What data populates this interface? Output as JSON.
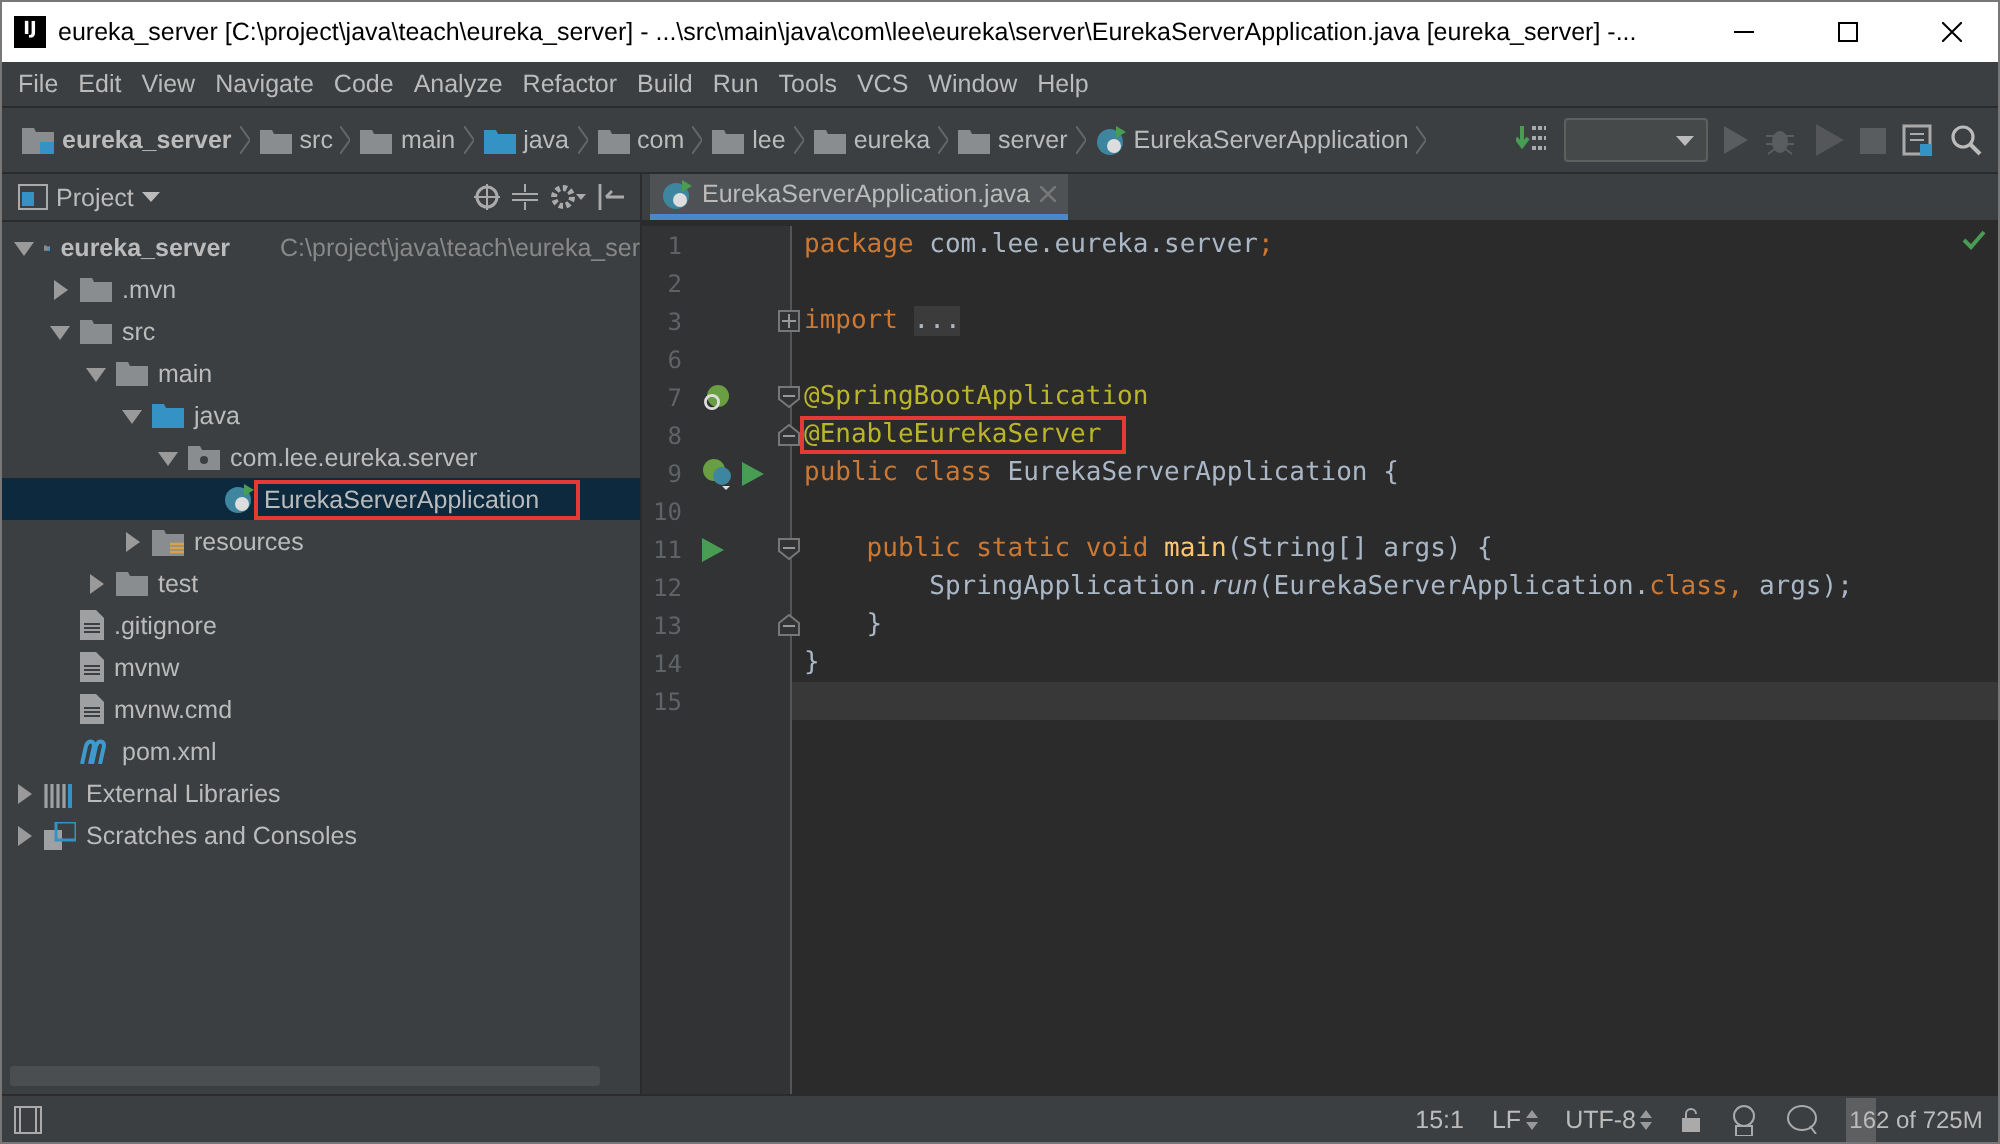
{
  "window": {
    "logo": "IJ",
    "title": "eureka_server [C:\\project\\java\\teach\\eureka_server] - ...\\src\\main\\java\\com\\lee\\eureka\\server\\EurekaServerApplication.java [eureka_server] -..."
  },
  "menu": [
    {
      "label": "File"
    },
    {
      "label": "Edit"
    },
    {
      "label": "View"
    },
    {
      "label": "Navigate"
    },
    {
      "label": "Code"
    },
    {
      "label": "Analyze"
    },
    {
      "label": "Refactor"
    },
    {
      "label": "Build"
    },
    {
      "label": "Run"
    },
    {
      "label": "Tools"
    },
    {
      "label": "VCS"
    },
    {
      "label": "Window"
    },
    {
      "label": "Help"
    }
  ],
  "breadcrumbs": [
    {
      "label": "eureka_server",
      "kind": "module"
    },
    {
      "label": "src",
      "kind": "folder"
    },
    {
      "label": "main",
      "kind": "folder"
    },
    {
      "label": "java",
      "kind": "source"
    },
    {
      "label": "com",
      "kind": "package"
    },
    {
      "label": "lee",
      "kind": "package"
    },
    {
      "label": "eureka",
      "kind": "package"
    },
    {
      "label": "server",
      "kind": "package"
    },
    {
      "label": "EurekaServerApplication",
      "kind": "class"
    }
  ],
  "project_panel": {
    "title": "Project",
    "tree": [
      {
        "label": "eureka_server",
        "path": "C:\\project\\java\\teach\\eureka_ser",
        "kind": "module",
        "expanded": true,
        "selected": false,
        "marked": false,
        "children": [
          {
            "label": ".mvn",
            "kind": "folder",
            "expanded": false,
            "selected": false,
            "marked": false
          },
          {
            "label": "src",
            "kind": "folder",
            "expanded": true,
            "selected": false,
            "marked": false,
            "children": [
              {
                "label": "main",
                "kind": "folder",
                "expanded": true,
                "selected": false,
                "marked": false,
                "children": [
                  {
                    "label": "java",
                    "kind": "source",
                    "expanded": true,
                    "selected": false,
                    "marked": false,
                    "children": [
                      {
                        "label": "com.lee.eureka.server",
                        "kind": "package",
                        "expanded": true,
                        "selected": false,
                        "marked": false,
                        "children": [
                          {
                            "label": "EurekaServerApplication",
                            "kind": "class",
                            "selected": true,
                            "marked": true
                          }
                        ]
                      }
                    ]
                  },
                  {
                    "label": "resources",
                    "kind": "resources",
                    "expanded": false,
                    "selected": false,
                    "marked": false
                  }
                ]
              },
              {
                "label": "test",
                "kind": "folder",
                "expanded": false,
                "selected": false,
                "marked": false
              }
            ]
          },
          {
            "label": ".gitignore",
            "kind": "file",
            "selected": false,
            "marked": false
          },
          {
            "label": "mvnw",
            "kind": "file",
            "selected": false,
            "marked": false
          },
          {
            "label": "mvnw.cmd",
            "kind": "file",
            "selected": false,
            "marked": false
          },
          {
            "label": "pom.xml",
            "kind": "maven",
            "selected": false,
            "marked": false
          }
        ]
      },
      {
        "label": "External Libraries",
        "kind": "libraries",
        "expanded": false,
        "selected": false,
        "marked": false
      },
      {
        "label": "Scratches and Consoles",
        "kind": "scratches",
        "expanded": false,
        "selected": false,
        "marked": false
      }
    ]
  },
  "editor_tabs": [
    {
      "label": "EurekaServerApplication.java",
      "selected": true
    }
  ],
  "code": [
    {
      "number": "1",
      "tokens": [
        {
          "text": "package ",
          "kind": "keyword"
        },
        {
          "text": "com.lee.eureka.server",
          "kind": "plain"
        },
        {
          "text": ";",
          "kind": "keyword"
        }
      ]
    },
    {
      "number": "2"
    },
    {
      "number": "3",
      "fold": {
        "kind": "collapsed"
      },
      "tokens": [
        {
          "text": "import ",
          "kind": "keyword"
        },
        {
          "text": "...",
          "kind": "folded"
        }
      ]
    },
    {
      "number": "6"
    },
    {
      "number": "7",
      "fold": {
        "kind": "open"
      },
      "gutter": [
        {
          "kind": "bean"
        }
      ],
      "tokens": [
        {
          "text": "@SpringBootApplication",
          "kind": "annotation"
        }
      ]
    },
    {
      "number": "8",
      "marked": true,
      "fold": {
        "kind": "end"
      },
      "tokens": [
        {
          "text": "@EnableEurekaServer",
          "kind": "annotation"
        }
      ]
    },
    {
      "number": "9",
      "gutter": [
        {
          "kind": "spring-class"
        },
        {
          "kind": "run"
        }
      ],
      "tokens": [
        {
          "text": "public class ",
          "kind": "keyword"
        },
        {
          "text": "EurekaServerApplication {",
          "kind": "plain"
        }
      ]
    },
    {
      "number": "10"
    },
    {
      "number": "11",
      "fold": {
        "kind": "open"
      },
      "gutter": [
        {
          "kind": "run"
        }
      ],
      "tokens": [
        {
          "text": "    public static void ",
          "kind": "keyword"
        },
        {
          "text": "main",
          "kind": "method"
        },
        {
          "text": "(String[] args) {",
          "kind": "plain"
        }
      ]
    },
    {
      "number": "12",
      "tokens": [
        {
          "text": "        SpringApplication.",
          "kind": "plain"
        },
        {
          "text": "run",
          "kind": "italic"
        },
        {
          "text": "(EurekaServerApplication.",
          "kind": "plain"
        },
        {
          "text": "class",
          "kind": "keyword"
        },
        {
          "text": ", ",
          "kind": "keyword"
        },
        {
          "text": "args);",
          "kind": "plain"
        }
      ]
    },
    {
      "number": "13",
      "fold": {
        "kind": "end"
      },
      "tokens": [
        {
          "text": "    }",
          "kind": "plain"
        }
      ]
    },
    {
      "number": "14",
      "tokens": [
        {
          "text": "}",
          "kind": "plain"
        }
      ]
    },
    {
      "number": "15",
      "current": true
    }
  ],
  "status_bar": {
    "position": "15:1",
    "line_separator": "LF",
    "encoding": "UTF-8",
    "memory": {
      "text": "162 of 725M",
      "level": 0.22
    }
  }
}
